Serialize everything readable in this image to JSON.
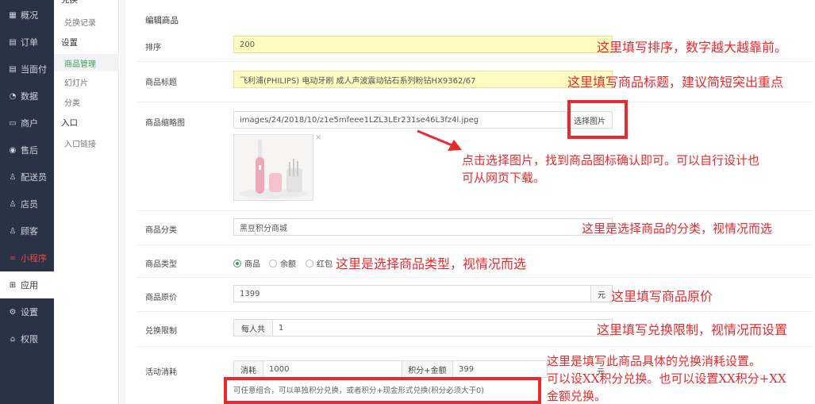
{
  "nav_primary": {
    "items": [
      {
        "label": "概况",
        "icon": "overview-icon",
        "glyph": "▦"
      },
      {
        "label": "订单",
        "icon": "order-icon",
        "glyph": "▤"
      },
      {
        "label": "当面付",
        "icon": "pay-icon",
        "glyph": "▤"
      },
      {
        "label": "数据",
        "icon": "data-icon",
        "glyph": "◔"
      },
      {
        "label": "商户",
        "icon": "merchant-icon",
        "glyph": "▭"
      },
      {
        "label": "售后",
        "icon": "aftersale-icon",
        "glyph": "◉"
      },
      {
        "label": "配送员",
        "icon": "delivery-icon",
        "glyph": "♙"
      },
      {
        "label": "店员",
        "icon": "clerk-icon",
        "glyph": "♙"
      },
      {
        "label": "顾客",
        "icon": "customer-icon",
        "glyph": "♙"
      },
      {
        "label": "小程序",
        "icon": "miniprogram-icon",
        "glyph": "∞"
      },
      {
        "label": "应用",
        "icon": "apps-icon",
        "glyph": "⊞"
      },
      {
        "label": "设置",
        "icon": "settings-icon",
        "glyph": "⚙"
      },
      {
        "label": "权限",
        "icon": "permission-icon",
        "glyph": "⌂"
      }
    ]
  },
  "nav_secondary": {
    "top_partial": "兑换",
    "items": [
      {
        "label": "兑换记录"
      },
      {
        "label": "设置"
      },
      {
        "label": "商品管理"
      },
      {
        "label": "幻灯片"
      },
      {
        "label": "分类"
      },
      {
        "label": "入口"
      },
      {
        "label": "入口链接"
      }
    ]
  },
  "form": {
    "title": "编辑商品",
    "sort": {
      "label": "排序",
      "value": "200"
    },
    "name": {
      "label": "商品标题",
      "value": "飞利浦(PHILIPS) 电动牙刷 成人声波震动钻石系列粉钻HX9362/67"
    },
    "thumb": {
      "label": "商品缩略图",
      "path": "images/24/2018/10/z1e5mfeee1LZL3LEr231se46L3fz4l.jpeg",
      "button": "选择图片",
      "remove": "×"
    },
    "category": {
      "label": "商品分类",
      "value": "黑豆积分商城"
    },
    "type": {
      "label": "商品类型",
      "options": [
        "商品",
        "余额",
        "红包"
      ],
      "selected": 0
    },
    "price": {
      "label": "商品原价",
      "value": "1399",
      "unit": "元"
    },
    "limit": {
      "label": "兑换限制",
      "prefix": "每人共",
      "value": "1"
    },
    "cost": {
      "label": "活动消耗",
      "prefix": "消耗",
      "value": "1000",
      "mid": "积分+金额",
      "value2": "399",
      "unit": "元"
    },
    "hint": "可任意组合，可以单独积分兑换，或者积分+现金形式兑换(积分必须大于0)"
  },
  "annotations": {
    "a1": "这里填写排序，数字越大越靠前。",
    "a2": "这里填写商品标题，建议简短突出重点",
    "a3_line1": "点击选择图片，找到商品图标确认即可。可以自行设计也",
    "a3_line2": "可从网页下载。",
    "a4": "这里是选择商品的分类，视情况而选",
    "a5": "这里是选择商品类型，视情况而选",
    "a6": "这里填写商品原价",
    "a7": "这里填写兑换限制，视情况而设置",
    "a8_line1": "这里是填写此商品具体的兑换消耗设置。",
    "a8_line2": "可以设XX积分兑换。也可以设置XX积分+XX",
    "a8_line3": "金额兑换。"
  },
  "colors": {
    "annotation": "#e8292e",
    "accent": "#3c9c5f",
    "highlight_input": "#fdfbc0",
    "nav_bg": "#2a3345"
  }
}
